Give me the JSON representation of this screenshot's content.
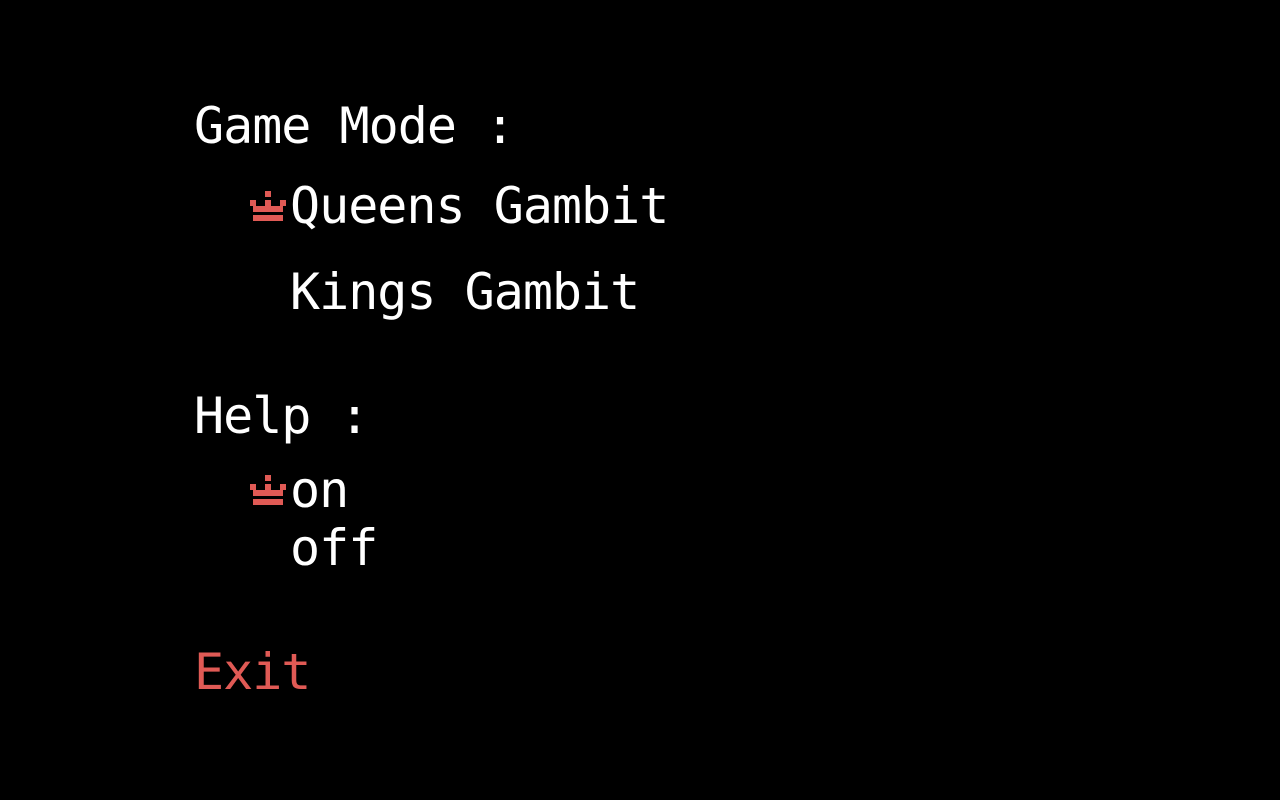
{
  "colors": {
    "background": "#000000",
    "text": "#ffffff",
    "accent": "#e05a55"
  },
  "game_mode": {
    "heading": "Game Mode :",
    "options": [
      {
        "label": "Queens Gambit",
        "selected": true
      },
      {
        "label": "Kings Gambit",
        "selected": false
      }
    ]
  },
  "help": {
    "heading": "Help :",
    "options": [
      {
        "label": "on",
        "selected": true
      },
      {
        "label": "off",
        "selected": false
      }
    ]
  },
  "exit": {
    "label": "Exit"
  },
  "icons": {
    "selection_marker": "crown-icon"
  }
}
